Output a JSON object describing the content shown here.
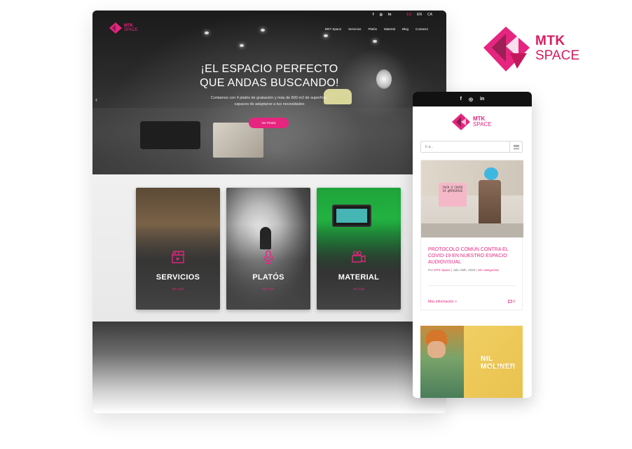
{
  "brand": {
    "name_line1": "MTK",
    "name_line2": "SPACE",
    "color": "#d81b60"
  },
  "desktop": {
    "topbar": {
      "social": [
        "f",
        "◎",
        "in"
      ],
      "languages": [
        "ES",
        "EN",
        "CA"
      ],
      "active_language": "ES"
    },
    "logo": {
      "line1": "MTK",
      "line2": "SPACE"
    },
    "nav": [
      "MKT Space",
      "Servicios",
      "Platós",
      "Material",
      "Blog",
      "Contacto"
    ],
    "hero": {
      "title_line1": "¡EL ESPACIO PERFECTO",
      "title_line2": "QUE ANDAS BUSCANDO!",
      "subtitle_line1": "Contamos con 4 platós de grabación y más de 800 m2 de superficie,",
      "subtitle_line2": "capaces de adaptarse a tus necesidades",
      "button_label": "Ver Platós",
      "prev_arrow": "‹"
    },
    "cards": [
      {
        "title": "SERVICIOS",
        "link": "Ver más",
        "icon": "clapperboard-icon"
      },
      {
        "title": "PLATÓS",
        "link": "Ver más",
        "icon": "microphone-icon"
      },
      {
        "title": "MATERIAL",
        "link": "Ver más",
        "icon": "camera-icon"
      }
    ],
    "accent_color": "#e5257f"
  },
  "mobile": {
    "topbar": {
      "social": [
        "f",
        "◎",
        "in"
      ]
    },
    "logo": {
      "line1": "MTK",
      "line2": "SPACE"
    },
    "search": {
      "placeholder": "Ir a..."
    },
    "post": {
      "title": "PROTOCOLO COMÚN CONTRA EL COVID-19 EN NUESTRO ESPACIO AUDIOVISUAL",
      "meta_prefix": "Por",
      "author": "MTK Space",
      "separator1": "|",
      "date": "Julio 25th, 2020",
      "separator2": "|",
      "category": "Sin categorizar",
      "more_label": "Más información >",
      "comments_count": "0",
      "comments_icon": "comment-icon",
      "image_sign": "FUCK U COVID 19 @MTKSPACE"
    },
    "post2": {
      "title": "NIL MOLINER",
      "subtitle": "MI RELIGIÓN"
    }
  }
}
